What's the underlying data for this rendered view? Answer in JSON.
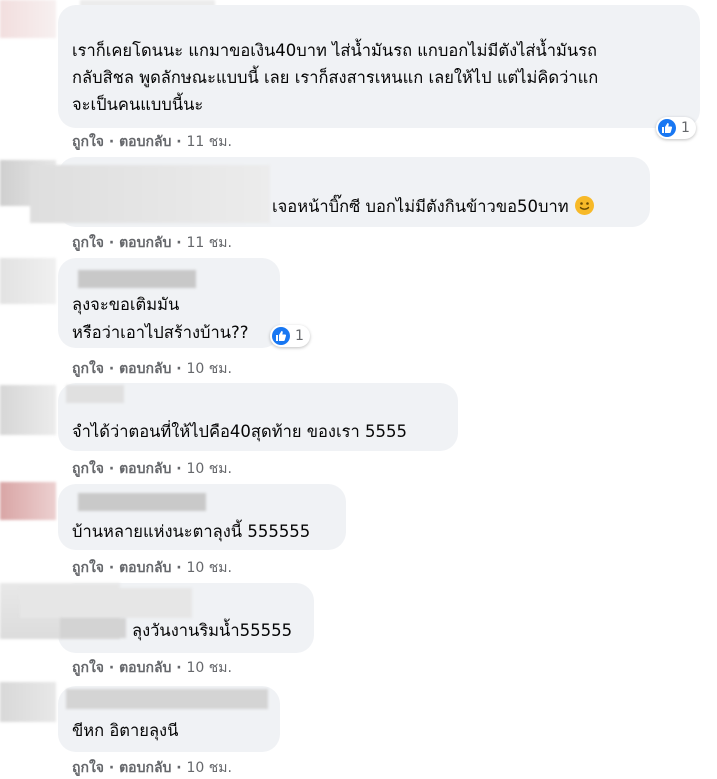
{
  "comments": [
    {
      "lines": [
        "เราก็เคยโดนนะ แกมาขอเงิน40บาท ไส่น้ำมันรถ แกบอกไม่มีตังไส่น้ำมันรถ",
        "กลับสิชล พูดลักษณะแบบนี้ เลย เราก็สงสารเหนแก เลยให้ไป แต่ไม่คิดว่าแก",
        "จะเป็นคนแบบนี้นะ"
      ],
      "like": "ถูกใจ",
      "reply": "ตอบกลับ",
      "time": "11 ชม.",
      "reactions": "1"
    },
    {
      "lines": [
        "เจอหน้าบิ๊กซี บอกไม่มีตังกินข้าวขอ50บาท"
      ],
      "emoji": "slightly-smiling-face",
      "like": "ถูกใจ",
      "reply": "ตอบกลับ",
      "time": "11 ชม."
    },
    {
      "lines": [
        "ลุงจะขอเติมมัน",
        "หรือว่าเอาไปสร้างบ้าน??"
      ],
      "like": "ถูกใจ",
      "reply": "ตอบกลับ",
      "time": "10 ชม.",
      "reactions": "1"
    },
    {
      "lines": [
        "จำได้ว่าตอนที่ให้ไปคือ40สุดท้าย ของเรา 5555"
      ],
      "like": "ถูกใจ",
      "reply": "ตอบกลับ",
      "time": "10 ชม."
    },
    {
      "lines": [
        "บ้านหลายแห่งนะตาลุงนี้ 555555"
      ],
      "like": "ถูกใจ",
      "reply": "ตอบกลับ",
      "time": "10 ชม."
    },
    {
      "lines": [
        "ลุงวันงานริมน้ำ55555"
      ],
      "like": "ถูกใจ",
      "reply": "ตอบกลับ",
      "time": "10 ชม."
    },
    {
      "lines": [
        "ขีหก อิตายลุงนี"
      ],
      "like": "ถูกใจ",
      "reply": "ตอบกลับ",
      "time": "10 ชม."
    }
  ],
  "colors": {
    "bubble": "#f0f2f5",
    "meta": "#65676b",
    "like_blue": "#1877f2"
  }
}
